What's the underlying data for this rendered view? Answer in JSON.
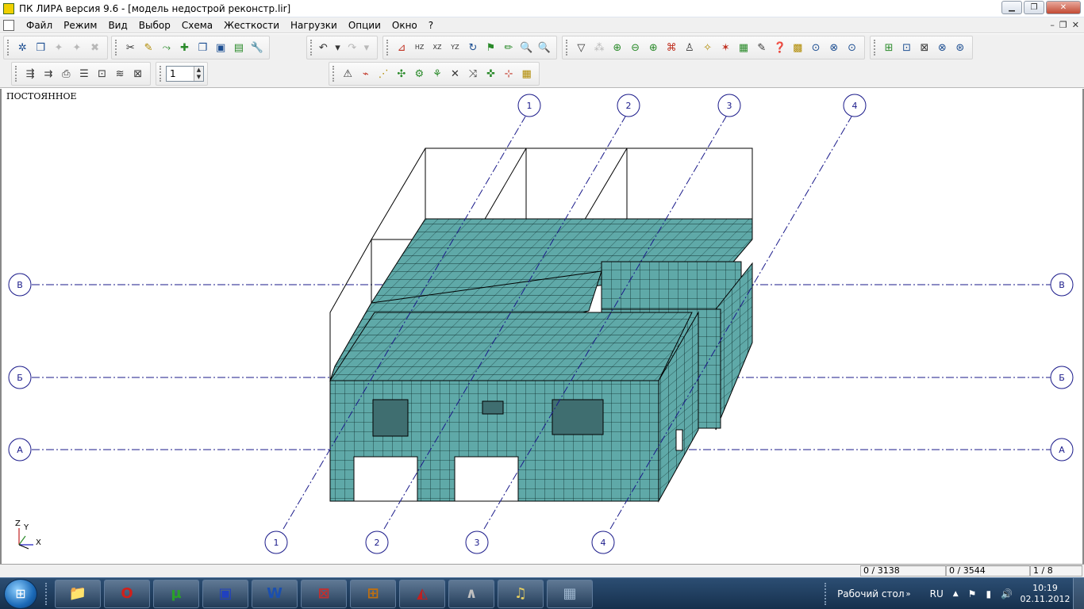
{
  "window": {
    "title": "ПК ЛИРА  версия 9.6 - [модель недострой реконстр.lir]",
    "controls": {
      "minimize": "▁",
      "maximize": "❐",
      "close": "✕"
    }
  },
  "menu": {
    "items": [
      "Файл",
      "Режим",
      "Вид",
      "Выбор",
      "Схема",
      "Жесткости",
      "Нагрузки",
      "Опции",
      "Окно",
      "?"
    ],
    "mdi_controls": {
      "minimize": "–",
      "restore": "❐",
      "close": "✕"
    }
  },
  "toolbar": {
    "row1_group1": [
      "✲",
      "❒",
      "✦",
      "✦",
      "✖"
    ],
    "row1_group2": [
      "✂",
      "✎",
      "⤳",
      "✚",
      "❐",
      "▣",
      "▤",
      "🔧"
    ],
    "row1_group3": [
      "↶",
      "▾",
      "↷",
      "▾"
    ],
    "row1_group4": [
      "⊿",
      "HZ",
      "XZ",
      "YZ",
      "↻",
      "⚑",
      "✏",
      "🔍",
      "🔍"
    ],
    "row1_group5": [
      "▽",
      "⁂",
      "⊕",
      "⊖",
      "⊕",
      "⌘",
      "♙",
      "✧",
      "✶",
      "▦",
      "✎",
      "❓",
      "▩",
      "⊙",
      "⊗",
      "⊙"
    ],
    "row1_group6": [
      "⊞",
      "⊡",
      "⊠",
      "⊗",
      "⊛"
    ],
    "row2_group1": [
      "⇶",
      "⇉",
      "⎙",
      "☰",
      "⊡",
      "≋",
      "⊠"
    ],
    "spin_value": "1",
    "row2_group2": [
      "⚠",
      "⌁",
      "⋰",
      "✣",
      "⚙",
      "⚘",
      "✕",
      "⤨",
      "✜",
      "⊹",
      "▦"
    ]
  },
  "view": {
    "load_case": "ПОСТОЯННОЕ",
    "axis_labels_numeric": [
      "1",
      "2",
      "3",
      "4"
    ],
    "axis_labels_letter": [
      "В",
      "Б",
      "А"
    ],
    "coord_axes": {
      "z": "Z",
      "y": "Y",
      "x": "X"
    },
    "mesh_color": "#5fa9a8",
    "axis_color": "#1a1a8a"
  },
  "status": {
    "nodes": "0 / 3138",
    "elements": "0 / 3544",
    "pages": "1 / 8"
  },
  "taskbar": {
    "start_icon": "⊞",
    "apps": [
      {
        "icon": "📁",
        "color": "#e8c060"
      },
      {
        "icon": "O",
        "color": "#d0201a"
      },
      {
        "icon": "µ",
        "color": "#2aa02a"
      },
      {
        "icon": "▣",
        "color": "#2040c0"
      },
      {
        "icon": "W",
        "color": "#1a4fb0"
      },
      {
        "icon": "⊠",
        "color": "#c03030"
      },
      {
        "icon": "⊞",
        "color": "#c07010"
      },
      {
        "icon": "◭",
        "color": "#c02020"
      },
      {
        "icon": "∧",
        "color": "#c0c0c0"
      },
      {
        "icon": "♫",
        "color": "#e8d060"
      },
      {
        "icon": "▦",
        "color": "#a0b8d0"
      }
    ],
    "desktop_label": "Рабочий стол",
    "desktop_arrow": "»",
    "language": "RU",
    "tray_icons": [
      "▲",
      "⚑",
      "▮",
      "🔊"
    ],
    "time": "10:19",
    "date": "02.11.2012"
  }
}
